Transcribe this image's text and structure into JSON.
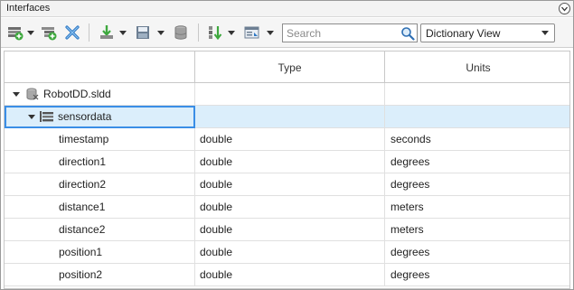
{
  "panel": {
    "title": "Interfaces"
  },
  "toolbar": {
    "buttons": [
      {
        "name": "add-interface-icon"
      },
      {
        "name": "add-element-icon"
      },
      {
        "name": "delete-icon"
      },
      {
        "name": "import-icon"
      },
      {
        "name": "save-icon"
      },
      {
        "name": "dictionary-icon"
      },
      {
        "name": "sort-icon"
      },
      {
        "name": "property-inspector-icon"
      }
    ],
    "search_placeholder": "Search",
    "view_selected": "Dictionary View"
  },
  "table": {
    "columns": [
      "",
      "Type",
      "Units"
    ],
    "dictionary": {
      "name": "RobotDD.sldd",
      "icon": "data-dictionary-icon"
    },
    "interface": {
      "name": "sensordata",
      "icon": "bus-interface-icon"
    },
    "elements": [
      {
        "name": "timestamp",
        "type": "double",
        "units": "seconds"
      },
      {
        "name": "direction1",
        "type": "double",
        "units": "degrees"
      },
      {
        "name": "direction2",
        "type": "double",
        "units": "degrees"
      },
      {
        "name": "distance1",
        "type": "double",
        "units": "meters"
      },
      {
        "name": "distance2",
        "type": "double",
        "units": "meters"
      },
      {
        "name": "position1",
        "type": "double",
        "units": "degrees"
      },
      {
        "name": "position2",
        "type": "double",
        "units": "degrees"
      }
    ]
  },
  "colors": {
    "selection": "#dbeefb",
    "focus": "#3a8ee6"
  }
}
